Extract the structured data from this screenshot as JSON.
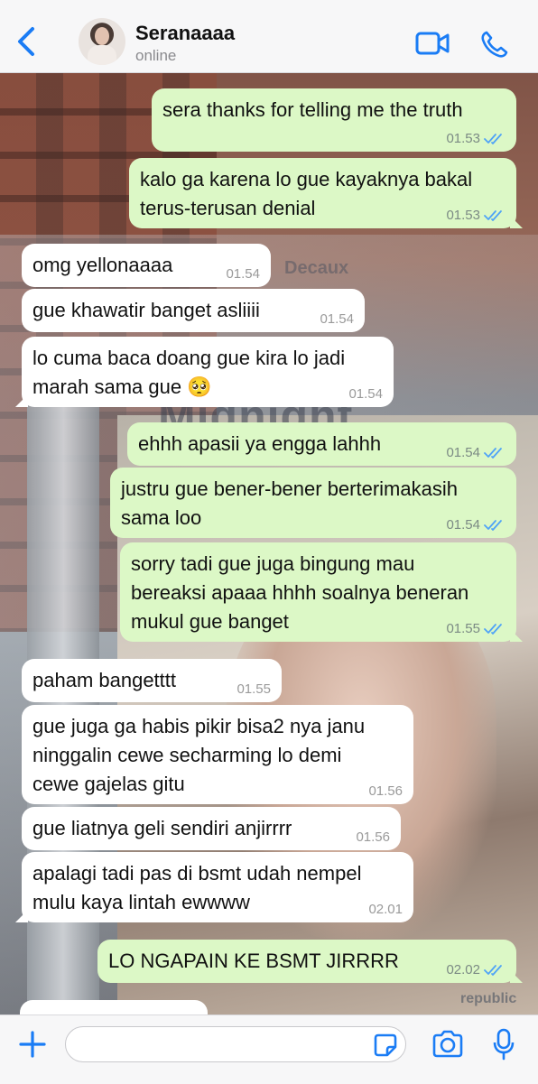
{
  "header": {
    "contact_name": "Seranaaaa",
    "status": "online"
  },
  "wallpaper_text": {
    "sign": "Decaux",
    "poster_title": "Midnight",
    "footer": "republic"
  },
  "messages": [
    {
      "dir": "out",
      "text": "sera thanks for telling me the truth",
      "time": "01.53",
      "read": true
    },
    {
      "dir": "out",
      "text": "kalo ga karena lo gue kayaknya bakal\nterus-terusan denial",
      "time": "01.53",
      "read": true
    },
    {
      "dir": "in",
      "text": "omg yellonaaaa",
      "time": "01.54"
    },
    {
      "dir": "in",
      "text": "gue khawatir banget asliiii",
      "time": "01.54"
    },
    {
      "dir": "in",
      "text": "lo cuma baca doang gue kira lo jadi\nmarah sama gue 🥺",
      "time": "01.54"
    },
    {
      "dir": "out",
      "text": "ehhh apasii ya engga lahhh",
      "time": "01.54",
      "read": true
    },
    {
      "dir": "out",
      "text": "justru gue bener-bener berterimakasih\nsama loo",
      "time": "01.54",
      "read": true
    },
    {
      "dir": "out",
      "text": "sorry tadi gue juga bingung mau\nbereaksi apaaa hhhh soalnya beneran\nmukul gue banget",
      "time": "01.55",
      "read": true
    },
    {
      "dir": "in",
      "text": "paham bangetttt",
      "time": "01.55"
    },
    {
      "dir": "in",
      "text": "gue juga ga habis pikir bisa2 nya janu\nninggalin cewe secharming lo demi\ncewe gajelas gitu",
      "time": "01.56"
    },
    {
      "dir": "in",
      "text": "gue liatnya geli sendiri anjirrrr",
      "time": "01.56"
    },
    {
      "dir": "in",
      "text": "apalagi tadi pas di bsmt udah nempel\nmulu kaya lintah ewwww",
      "time": "02.01"
    },
    {
      "dir": "out",
      "text": "LO NGAPAIN KE BSMT JIRRRR",
      "time": "02.02",
      "read": true
    }
  ],
  "colors": {
    "outgoing_bubble": "#dcf8c6",
    "incoming_bubble": "#ffffff",
    "accent": "#1a7cf5",
    "read_tick": "#4fa3f7"
  },
  "icons": [
    "back-chevron-icon",
    "video-call-icon",
    "phone-call-icon",
    "plus-icon",
    "sticker-icon",
    "camera-icon",
    "microphone-icon"
  ]
}
